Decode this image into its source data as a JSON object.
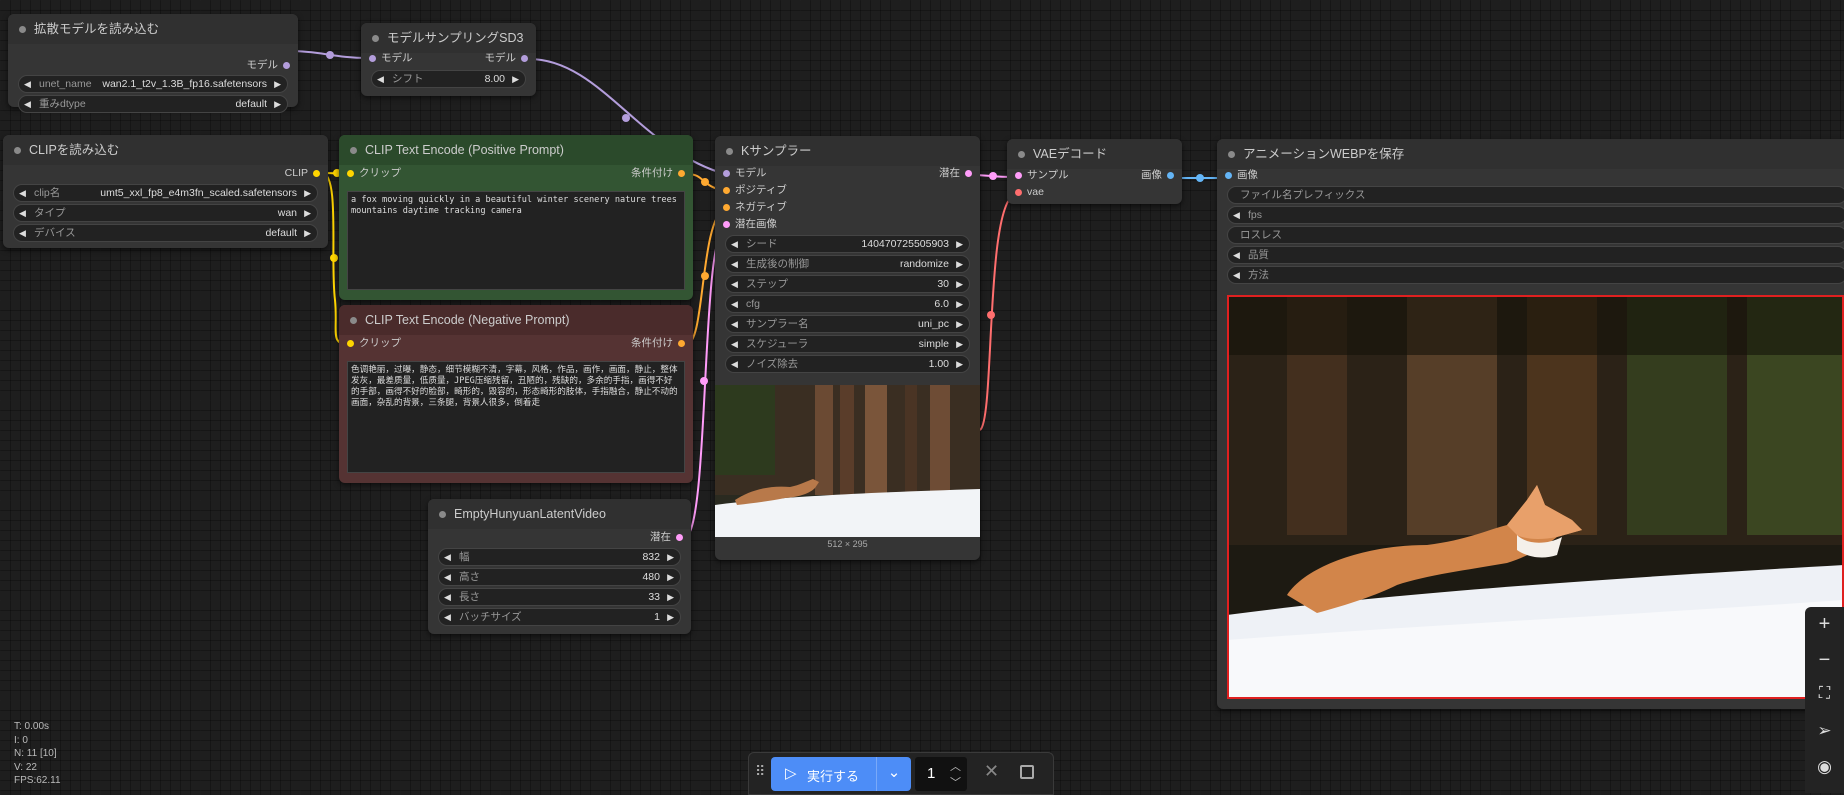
{
  "nodes": {
    "load_diffusion": {
      "title": "拡散モデルを読み込む",
      "out_model": "モデル",
      "unet_label": "unet_name",
      "unet_value": "wan2.1_t2v_1.3B_fp16.safetensors",
      "dtype_label": "重みdtype",
      "dtype_value": "default"
    },
    "sampling_sd3": {
      "title": "モデルサンプリングSD3",
      "in_model": "モデル",
      "out_model": "モデル",
      "shift_label": "シフト",
      "shift_value": "8.00"
    },
    "load_clip": {
      "title": "CLIPを読み込む",
      "out_clip": "CLIP",
      "clipname_label": "clip名",
      "clipname_value": "umt5_xxl_fp8_e4m3fn_scaled.safetensors",
      "type_label": "タイプ",
      "type_value": "wan",
      "device_label": "デバイス",
      "device_value": "default"
    },
    "positive": {
      "title": "CLIP Text Encode (Positive Prompt)",
      "in_clip": "クリップ",
      "out_cond": "条件付け",
      "text": "a fox moving quickly in a beautiful winter scenery nature trees mountains daytime tracking camera"
    },
    "negative": {
      "title": "CLIP Text Encode (Negative Prompt)",
      "in_clip": "クリップ",
      "out_cond": "条件付け",
      "text": "色调艳丽，过曝，静态，细节模糊不清，字幕，风格，作品，画作，画面，静止，整体发灰，最差质量，低质量，JPEG压缩残留，丑陋的，残缺的，多余的手指，画得不好的手部，画得不好的脸部，畸形的，毁容的，形态畸形的肢体，手指融合，静止不动的画面，杂乱的背景，三条腿，背景人很多，倒着走"
    },
    "latent": {
      "title": "EmptyHunyuanLatentVideo",
      "out_latent": "潜在",
      "width_label": "幅",
      "width_value": "832",
      "height_label": "高さ",
      "height_value": "480",
      "length_label": "長さ",
      "length_value": "33",
      "batch_label": "バッチサイズ",
      "batch_value": "1"
    },
    "ksampler": {
      "title": "Kサンプラー",
      "in_model": "モデル",
      "in_pos": "ポジティブ",
      "in_neg": "ネガティブ",
      "in_latent": "潜在画像",
      "out_latent": "潜在",
      "widgets": [
        {
          "label": "シード",
          "value": "140470725505903"
        },
        {
          "label": "生成後の制御",
          "value": "randomize"
        },
        {
          "label": "ステップ",
          "value": "30"
        },
        {
          "label": "cfg",
          "value": "6.0"
        },
        {
          "label": "サンプラー名",
          "value": "uni_pc"
        },
        {
          "label": "スケジューラ",
          "value": "simple"
        },
        {
          "label": "ノイズ除去",
          "value": "1.00"
        }
      ],
      "preview_size": "512 × 295"
    },
    "vae_decode": {
      "title": "VAEデコード",
      "in_samples": "サンプル",
      "in_vae": "vae",
      "out_image": "画像"
    },
    "save_webp": {
      "title": "アニメーションWEBPを保存",
      "in_images": "画像",
      "prefix_label": "ファイル名プレフィックス",
      "fps_label": "fps",
      "lossless_label": "ロスレス",
      "quality_label": "品質",
      "method_label": "方法"
    }
  },
  "stats": {
    "t": "T: 0.00s",
    "i": "I: 0",
    "n": "N: 11 [10]",
    "v": "V: 22",
    "fps": "FPS:62.11"
  },
  "runbar": {
    "run_label": "実行する",
    "count": "1"
  },
  "colors": {
    "model_link": "#b39ddb",
    "clip_link": "#ffd500",
    "cond_link": "#ffa931",
    "latent_link": "#ff9cf9",
    "vae_link": "#ff6e6e",
    "image_link": "#64b5f6",
    "accent_blue": "#4d8df7",
    "highlight_red": "#e02020"
  },
  "icons": [
    "play-icon",
    "chevron-down-icon",
    "close-icon",
    "stop-icon",
    "zoom-in-icon",
    "zoom-out-icon",
    "fit-view-icon",
    "navigate-icon",
    "eye-icon",
    "drag-handle-icon"
  ]
}
